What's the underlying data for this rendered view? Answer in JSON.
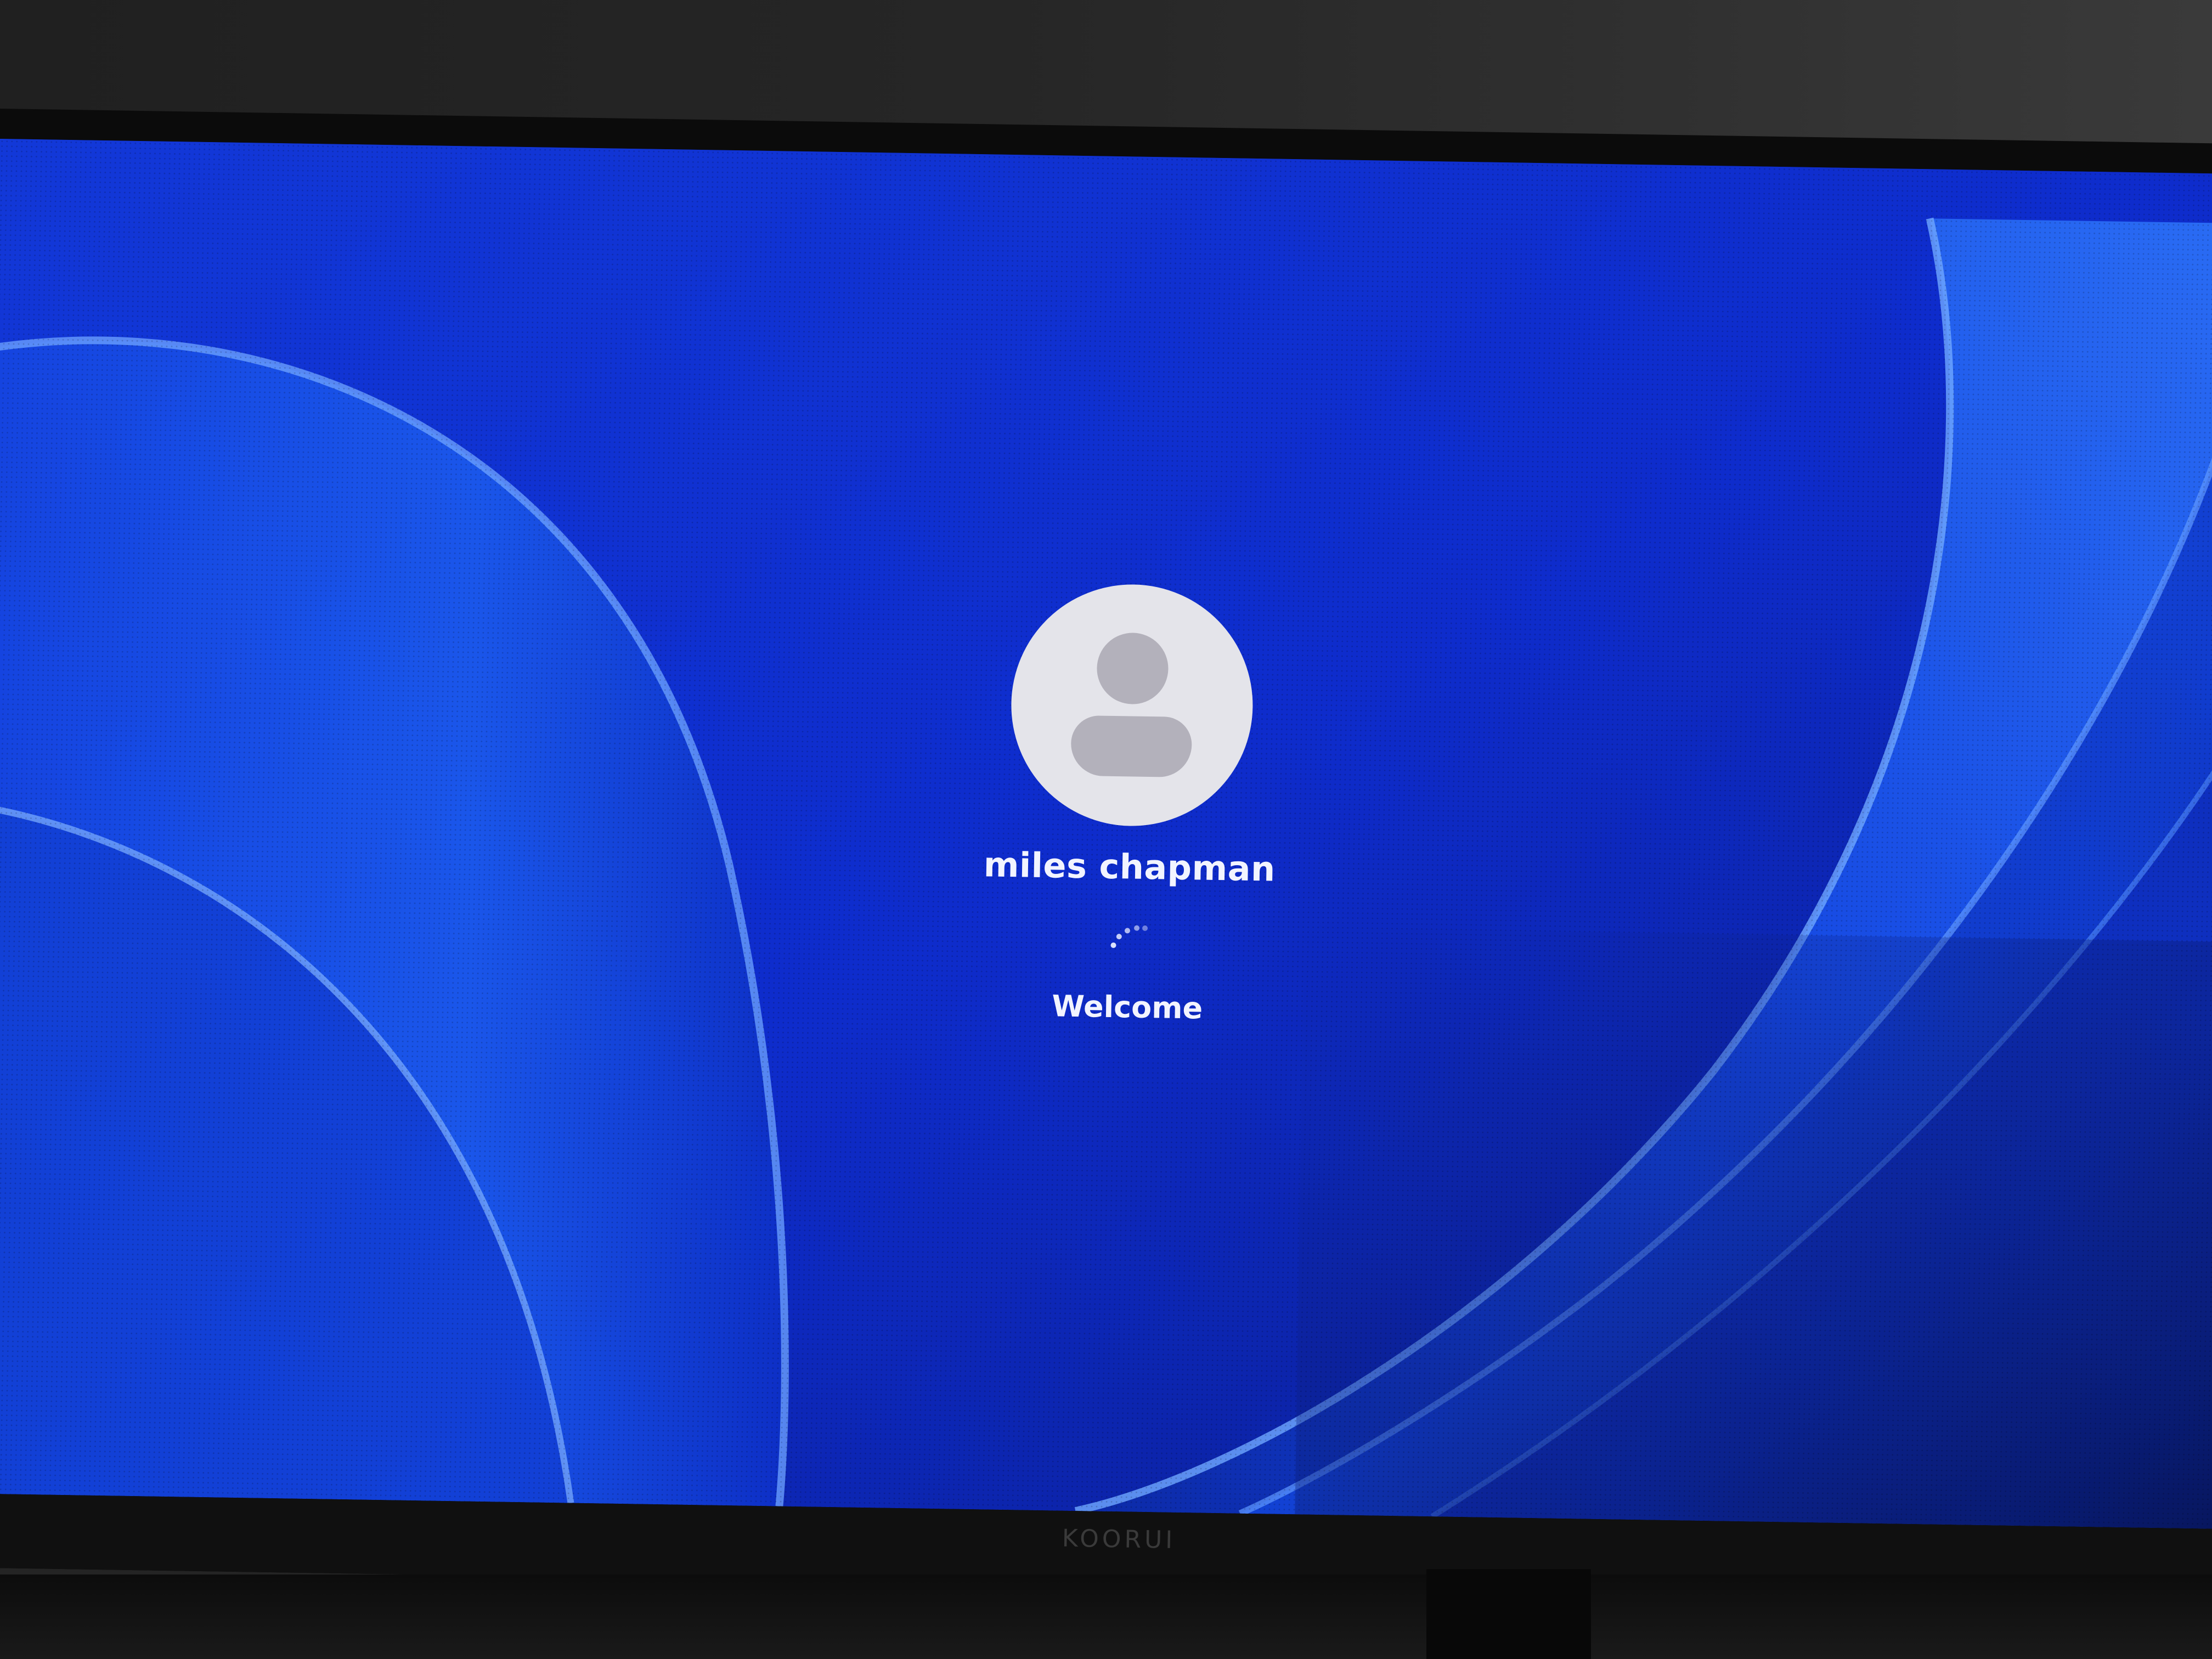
{
  "login": {
    "user_name": "miles chapman",
    "status_text": "Welcome"
  },
  "icons": {
    "avatar": "default-user-avatar-icon",
    "spinner": "loading-spinner-icon"
  },
  "monitor": {
    "brand": "KOORUI"
  },
  "colors": {
    "wallpaper_blue": "#0f2fd0",
    "wallpaper_light": "#3f7cf0",
    "avatar_bg": "#e4e4ea",
    "avatar_figure": "#b3b1bb",
    "text": "#f2f4ff"
  }
}
